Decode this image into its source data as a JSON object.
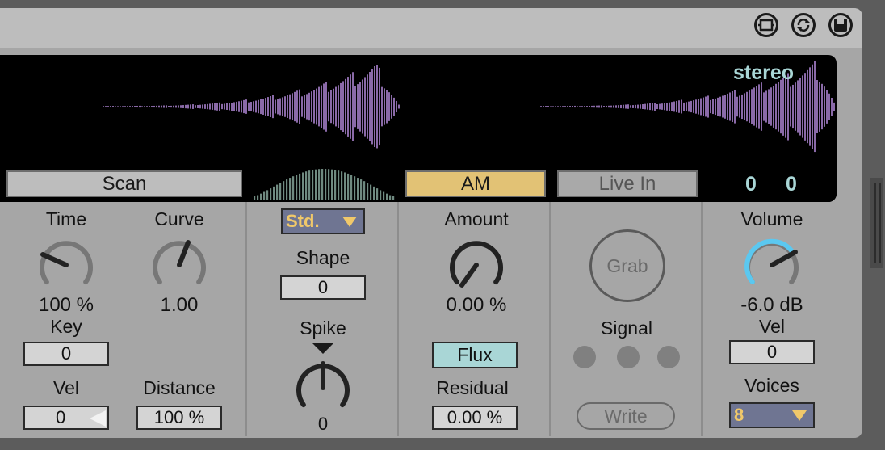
{
  "titlebar": {
    "buttons": [
      "clip-icon",
      "refresh-icon",
      "save-icon"
    ]
  },
  "display": {
    "channel_mode": "stereo",
    "position_left": "0",
    "position_right": "0"
  },
  "scan": {
    "button_label": "Scan",
    "time": {
      "label": "Time",
      "value": "100 %"
    },
    "curve": {
      "label": "Curve",
      "value": "1.00"
    },
    "key": {
      "label": "Key",
      "value": "0"
    },
    "vel": {
      "label": "Vel",
      "value": "0"
    },
    "distance": {
      "label": "Distance",
      "value": "100 %"
    }
  },
  "envelope": {
    "mode_selected": "Std.",
    "shape": {
      "label": "Shape",
      "value": "0"
    },
    "spike": {
      "label": "Spike",
      "value": "0"
    }
  },
  "am": {
    "button_label": "AM",
    "amount": {
      "label": "Amount",
      "value": "0.00 %"
    },
    "flux_label": "Flux",
    "residual": {
      "label": "Residual",
      "value": "0.00 %"
    }
  },
  "live_in": {
    "button_label": "Live In",
    "grab_label": "Grab",
    "signal_label": "Signal",
    "write_label": "Write"
  },
  "output": {
    "volume": {
      "label": "Volume",
      "value": "-6.0 dB"
    },
    "vel": {
      "label": "Vel",
      "value": "0"
    },
    "voices": {
      "label": "Voices",
      "value": "8"
    }
  },
  "colors": {
    "accent_am": "#e2c275",
    "waveform": "#8a6aa8",
    "volume_arc": "#5bc8f0",
    "flux_bg": "#a9d6d6",
    "display_text": "#a9d6d6"
  }
}
